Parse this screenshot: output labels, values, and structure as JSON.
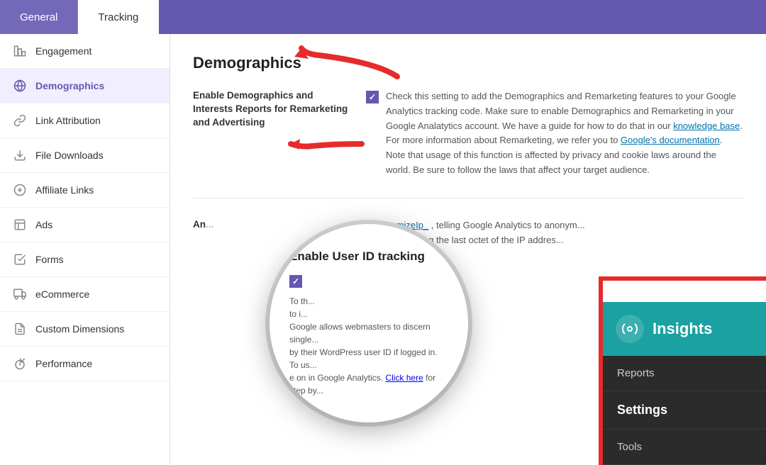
{
  "tabs": [
    {
      "id": "general",
      "label": "General",
      "active": false
    },
    {
      "id": "tracking",
      "label": "Tracking",
      "active": true
    }
  ],
  "sidebar": {
    "items": [
      {
        "id": "engagement",
        "label": "Engagement",
        "icon": "📊",
        "active": false
      },
      {
        "id": "demographics",
        "label": "Demographics",
        "icon": "🌐",
        "active": true
      },
      {
        "id": "link-attribution",
        "label": "Link Attribution",
        "icon": "🔗",
        "active": false
      },
      {
        "id": "file-downloads",
        "label": "File Downloads",
        "icon": "⬇",
        "active": false
      },
      {
        "id": "affiliate-links",
        "label": "Affiliate Links",
        "icon": "💲",
        "active": false
      },
      {
        "id": "ads",
        "label": "Ads",
        "icon": "📋",
        "active": false
      },
      {
        "id": "forms",
        "label": "Forms",
        "icon": "✅",
        "active": false
      },
      {
        "id": "ecommerce",
        "label": "eCommerce",
        "icon": "🛍",
        "active": false
      },
      {
        "id": "custom-dimensions",
        "label": "Custom Dimensions",
        "icon": "📄",
        "active": false
      },
      {
        "id": "performance",
        "label": "Performance",
        "icon": "⚡",
        "active": false
      }
    ]
  },
  "content": {
    "title": "Demographics",
    "settings": [
      {
        "id": "demographics-setting",
        "label": "Enable Demographics and Interests Reports for Remarketing and Advertising",
        "checked": true,
        "description": "Check this setting to add the Demographics and Remarketing features to your Google Analytics tracking code. Make sure to enable Demographics and Remarketing in your Google Analatytics account. We have a guide for how to do that in our",
        "link1_text": "knowledge base",
        "link1_suffix": ". For more information about Remarketing, we refer you to",
        "link2_text": "Google's documentation",
        "link2_suffix": ". Note that usage of this function is affected by privacy and cookie laws around the world. Be sure to follow the laws that affect your target audience."
      }
    ],
    "anonymize_section": {
      "label": "An...",
      "partial_text": "_anonymizeIp_ , telling Google Analytics to anonym...",
      "partial_text2": "...ts by removing the last octet of the IP addres..."
    }
  },
  "magnify": {
    "label": "Enable User ID tracking",
    "checked": true,
    "text": "To th... to i... tu..."
  },
  "insights_panel": {
    "title": "Insights",
    "icon": "⚙",
    "menu_items": [
      {
        "id": "reports",
        "label": "Reports",
        "active": false
      },
      {
        "id": "settings",
        "label": "Settings",
        "active": true
      },
      {
        "id": "tools",
        "label": "Tools",
        "active": false
      }
    ]
  }
}
